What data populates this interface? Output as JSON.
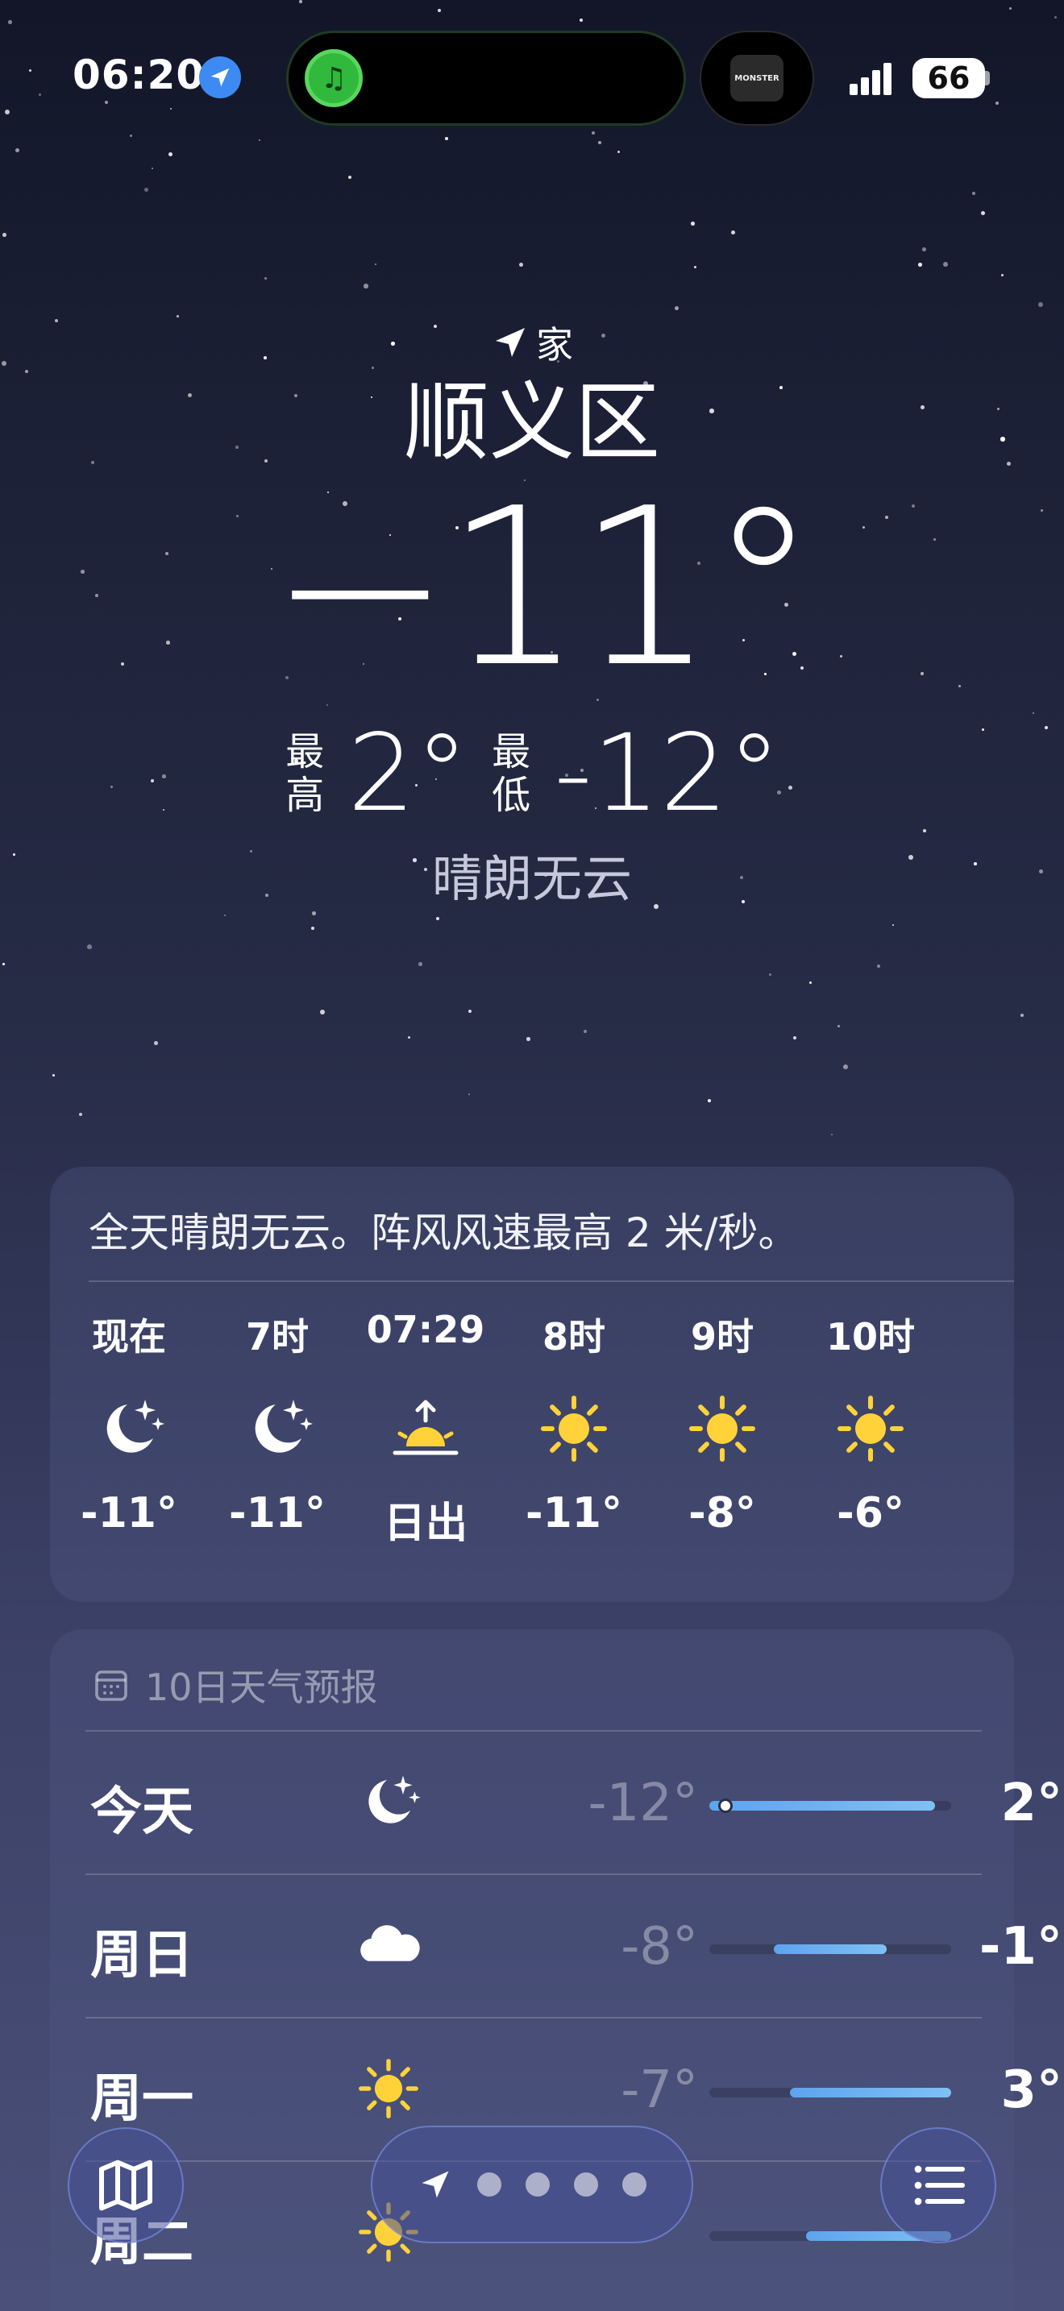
{
  "status_bar": {
    "time": "06:20",
    "battery": "66",
    "island_right_label": "MONSTER",
    "icons": [
      "location-arrow-icon",
      "music-app-icon",
      "cellular-signal-icon",
      "battery-icon"
    ]
  },
  "location": {
    "tag": "家",
    "city": "顺义区"
  },
  "current": {
    "temperature": "−11°",
    "high_label": "最高",
    "high": "2°",
    "low_label": "最低",
    "low": "-12°",
    "condition": "晴朗无云"
  },
  "hourly": {
    "summary": "全天晴朗无云。阵风风速最高 2 米/秒。",
    "items": [
      {
        "label": "现在",
        "icon": "moon-stars-icon",
        "temp": "-11°"
      },
      {
        "label": "7时",
        "icon": "moon-stars-icon",
        "temp": "-11°"
      },
      {
        "label": "07:29",
        "icon": "sunrise-icon",
        "temp": "日出"
      },
      {
        "label": "8时",
        "icon": "sun-icon",
        "temp": "-11°"
      },
      {
        "label": "9时",
        "icon": "sun-icon",
        "temp": "-8°"
      },
      {
        "label": "10时",
        "icon": "sun-icon",
        "temp": "-6°"
      }
    ]
  },
  "daily": {
    "title": "10日天气预报",
    "range": [
      -12,
      3
    ],
    "items": [
      {
        "day": "今天",
        "icon": "moon-stars-icon",
        "low": "-12°",
        "high": "2°",
        "low_value": -12,
        "high_value": 2,
        "current": -11
      },
      {
        "day": "周日",
        "icon": "cloud-icon",
        "low": "-8°",
        "high": "-1°",
        "low_value": -8,
        "high_value": -1
      },
      {
        "day": "周一",
        "icon": "sun-icon",
        "low": "-7°",
        "high": "3°",
        "low_value": -7,
        "high_value": 3
      },
      {
        "day": "周二",
        "icon": "sun-icon",
        "low": "",
        "high": "",
        "low_value": -6,
        "high_value": 3
      }
    ]
  },
  "colors": {
    "accent_blue": "#3d8bf2",
    "sun_yellow": "#ffd23a",
    "range_bar": "#5ea4ee"
  },
  "toolbar": {
    "left_icon": "map-icon",
    "right_icon": "list-icon",
    "page_count": 4
  }
}
